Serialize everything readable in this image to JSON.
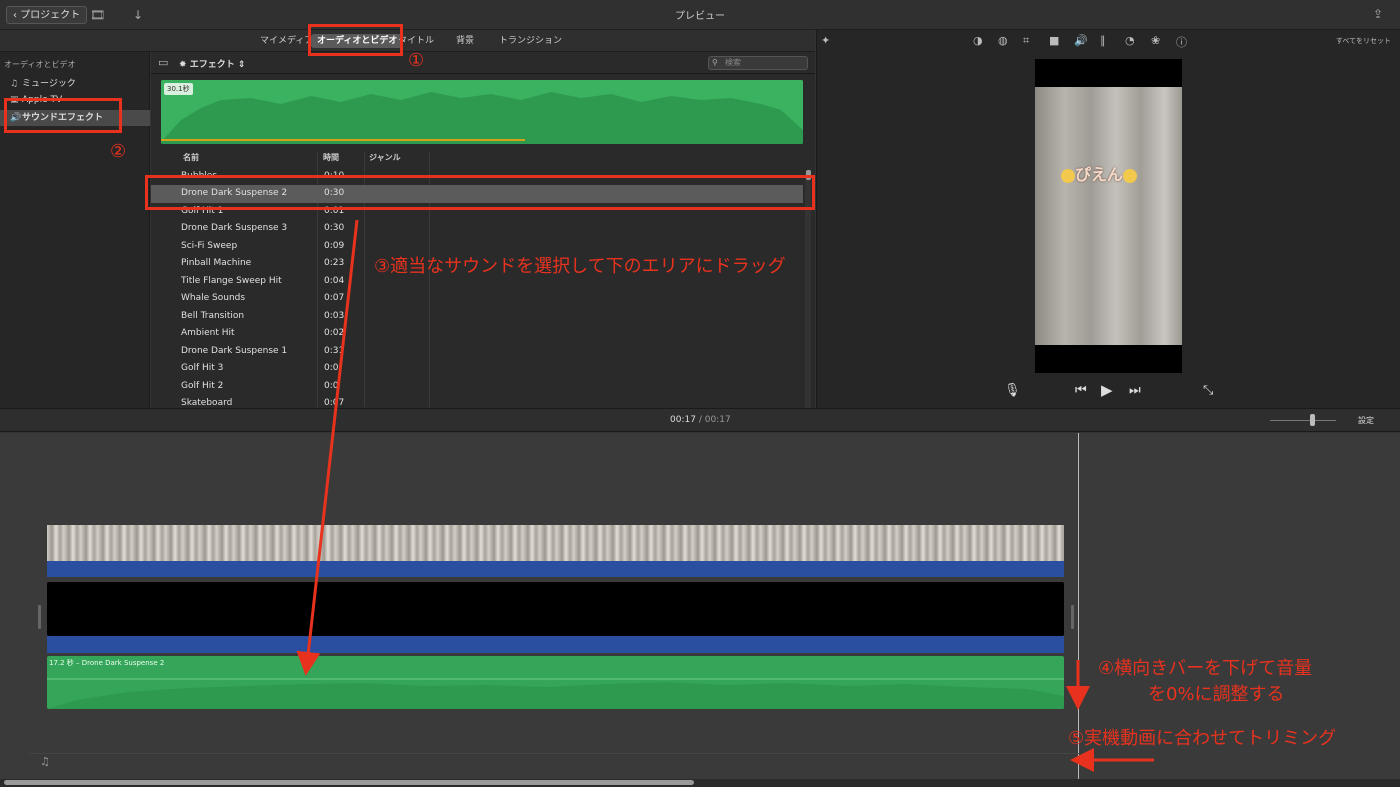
{
  "toolbar": {
    "back_label": "プロジェクト",
    "title": "プレビュー"
  },
  "browser_tabs": {
    "my_media": "マイメディア",
    "audio_video": "オーディオとビデオ",
    "titles": "タイトル",
    "backgrounds": "背景",
    "transitions": "トランジション"
  },
  "sidebar": {
    "heading": "オーディオとビデオ",
    "items": [
      {
        "label": "ミュージック",
        "icon": "music-icon"
      },
      {
        "label": "Apple TV",
        "icon": "tv-icon"
      },
      {
        "label": "サウンドエフェクト",
        "icon": "speaker-icon"
      }
    ]
  },
  "list": {
    "category": "エフェクト",
    "search_placeholder": "検索",
    "waveform_badge": "30.1秒",
    "columns": {
      "name": "名前",
      "time": "時間",
      "genre": "ジャンル"
    },
    "rows": [
      {
        "name": "Bubbles",
        "time": "0:10"
      },
      {
        "name": "Drone Dark Suspense 2",
        "time": "0:30"
      },
      {
        "name": "Golf Hit 1",
        "time": "0:01"
      },
      {
        "name": "Drone Dark Suspense 3",
        "time": "0:30"
      },
      {
        "name": "Sci-Fi Sweep",
        "time": "0:09"
      },
      {
        "name": "Pinball Machine",
        "time": "0:23"
      },
      {
        "name": "Title Flange Sweep Hit",
        "time": "0:04"
      },
      {
        "name": "Whale Sounds",
        "time": "0:07"
      },
      {
        "name": "Bell Transition",
        "time": "0:03"
      },
      {
        "name": "Ambient Hit",
        "time": "0:02"
      },
      {
        "name": "Drone Dark Suspense 1",
        "time": "0:31"
      },
      {
        "name": "Golf Hit 3",
        "time": "0:0"
      },
      {
        "name": "Golf Hit 2",
        "time": "0:0"
      },
      {
        "name": "Skateboard",
        "time": "0:07"
      }
    ]
  },
  "viewer": {
    "reset_all": "すべてをリセット",
    "sticker_text": "ぴえん"
  },
  "timeline": {
    "current_time": "00:17",
    "separator": "/",
    "total_time": "00:17",
    "settings_label": "設定",
    "audio_clip_label": "17.2 秒 – Drone Dark Suspense 2"
  },
  "annotations": {
    "n1": "①",
    "n2": "②",
    "step3": "③適当なサウンドを選択して下のエリアにドラッグ",
    "step4_line1": "④横向きバーを下げて音量",
    "step4_line2": "を0%に調整する",
    "step5": "⑤実機動画に合わせてトリミング"
  },
  "colors": {
    "annotation": "#e8321e",
    "waveform": "#3bb260",
    "clip_blue": "#2a4fa0"
  }
}
